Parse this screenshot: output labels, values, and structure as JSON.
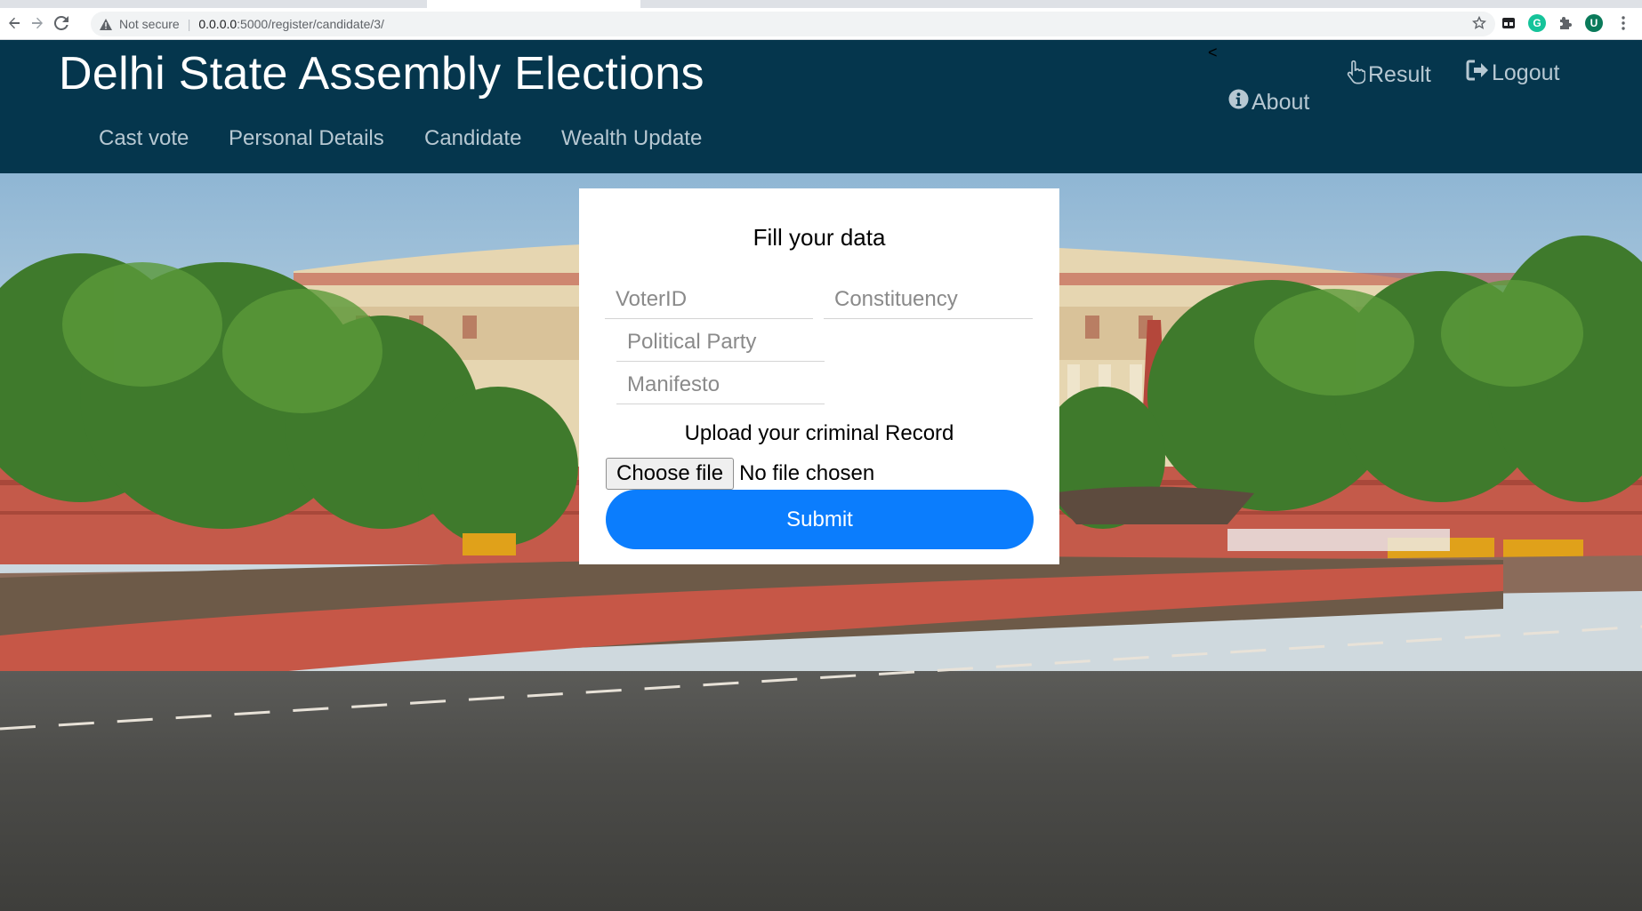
{
  "browser": {
    "security_label": "Not secure",
    "url_host": "0.0.0.0",
    "url_path": ":5000/register/candidate/3/",
    "profile_initial": "U",
    "extension_initial": "G"
  },
  "header": {
    "title": "Delhi State Assembly Elections",
    "caret": "<",
    "nav": {
      "cast_vote": "Cast vote",
      "personal_details": "Personal Details",
      "candidate": "Candidate",
      "wealth_update": "Wealth Update"
    },
    "links": {
      "result": "Result",
      "logout": "Logout",
      "about": "About"
    }
  },
  "form": {
    "title": "Fill your data",
    "voter_id_placeholder": "VoterID",
    "constituency_placeholder": "Constituency",
    "party_placeholder": "Political Party",
    "manifesto_placeholder": "Manifesto",
    "upload_label": "Upload your criminal Record",
    "choose_file_label": "Choose file",
    "file_status": "No file chosen",
    "submit_label": "Submit"
  },
  "colors": {
    "header_bg": "#05364d",
    "nav_text": "#b7c8d2",
    "submit_bg": "#0b7dfd"
  },
  "icons": {
    "back": "arrow-left-icon",
    "forward": "arrow-right-icon",
    "reload": "reload-icon",
    "warning": "warning-icon",
    "bookmark": "star-icon",
    "result": "hand-pointer-icon",
    "logout": "sign-out-icon",
    "about": "info-circle-icon"
  }
}
